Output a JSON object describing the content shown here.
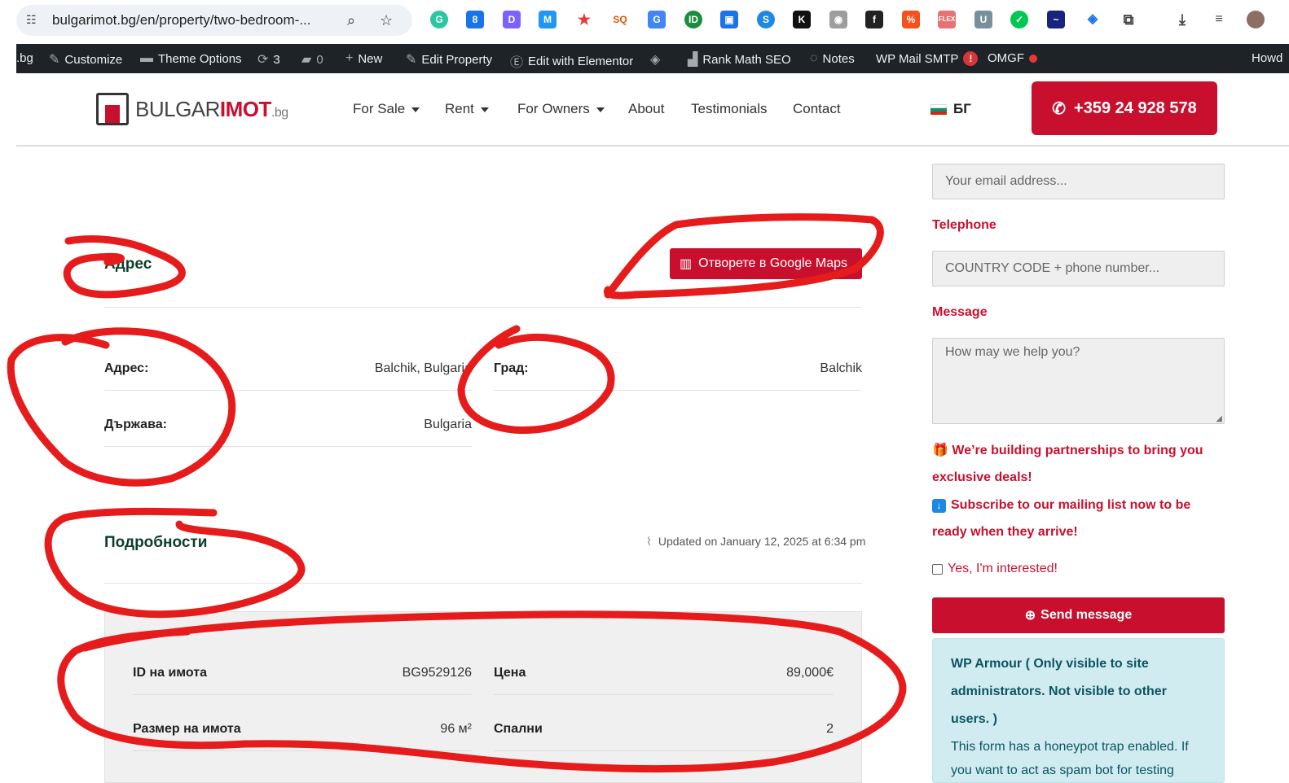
{
  "browser": {
    "url": "bulgarimot.bg/en/property/two-bedroom-...",
    "colors": {
      "pill": "#eef1f5"
    }
  },
  "admin_bar": {
    "site_fragment": ".bg",
    "customize": "Customize",
    "theme_options": "Theme Options",
    "updates_count": "3",
    "comments_count": "0",
    "new": "New",
    "edit_property": "Edit Property",
    "edit_elementor": "Edit with Elementor",
    "rank_math": "Rank Math SEO",
    "notes": "Notes",
    "wp_mail_smtp": "WP Mail SMTP",
    "smtp_alert": "!",
    "omgf": "OMGF",
    "howdy": "Howd"
  },
  "header": {
    "logo_part1": "BULGAR",
    "logo_part2": "IMOT",
    "logo_tld": ".bg",
    "nav": {
      "for_sale": "For Sale",
      "rent": "Rent",
      "for_owners": "For Owners",
      "about": "About",
      "testimonials": "Testimonials",
      "contact": "Contact"
    },
    "lang": "БГ",
    "phone": "+359 24 928 578"
  },
  "address_section": {
    "title": "Адрес",
    "maps_button": "Отворете в Google Maps",
    "address_label": "Адрес:",
    "address_value": "Balchik, Bulgaria",
    "city_label": "Град:",
    "city_value": "Balchik",
    "country_label": "Държава:",
    "country_value": "Bulgaria"
  },
  "details_section": {
    "title": "Подробности",
    "updated": "Updated on January 12, 2025 at 6:34 pm",
    "id_label": "ID на имота",
    "id_value": "BG9529126",
    "price_label": "Цена",
    "price_value": "89,000€",
    "size_label": "Размер на имота",
    "size_value": "96 м²",
    "bedrooms_label": "Спални",
    "bedrooms_value": "2"
  },
  "sidebar": {
    "email_placeholder": "Your email address...",
    "telephone_label": "Telephone",
    "phone_placeholder": "COUNTRY CODE + phone number...",
    "message_label": "Message",
    "message_placeholder": "How may we help you?",
    "promo1": "We’re building partnerships to bring you exclusive deals!",
    "promo2": "Subscribe to our mailing list now to be ready when they arrive!",
    "checkbox_label": "Yes, I'm interested!",
    "send_button": "Send message",
    "armour_title": "WP Armour ( Only visible to site administrators. Not visible to other users. )",
    "armour_text": "This form has a honeypot trap enabled. If you want to act as spam bot for testing"
  },
  "colors": {
    "brand_red": "#c8102e",
    "heading_green": "#0f3d2a",
    "admin_bar": "#1d2327",
    "annotation_red": "#e61c1c"
  }
}
